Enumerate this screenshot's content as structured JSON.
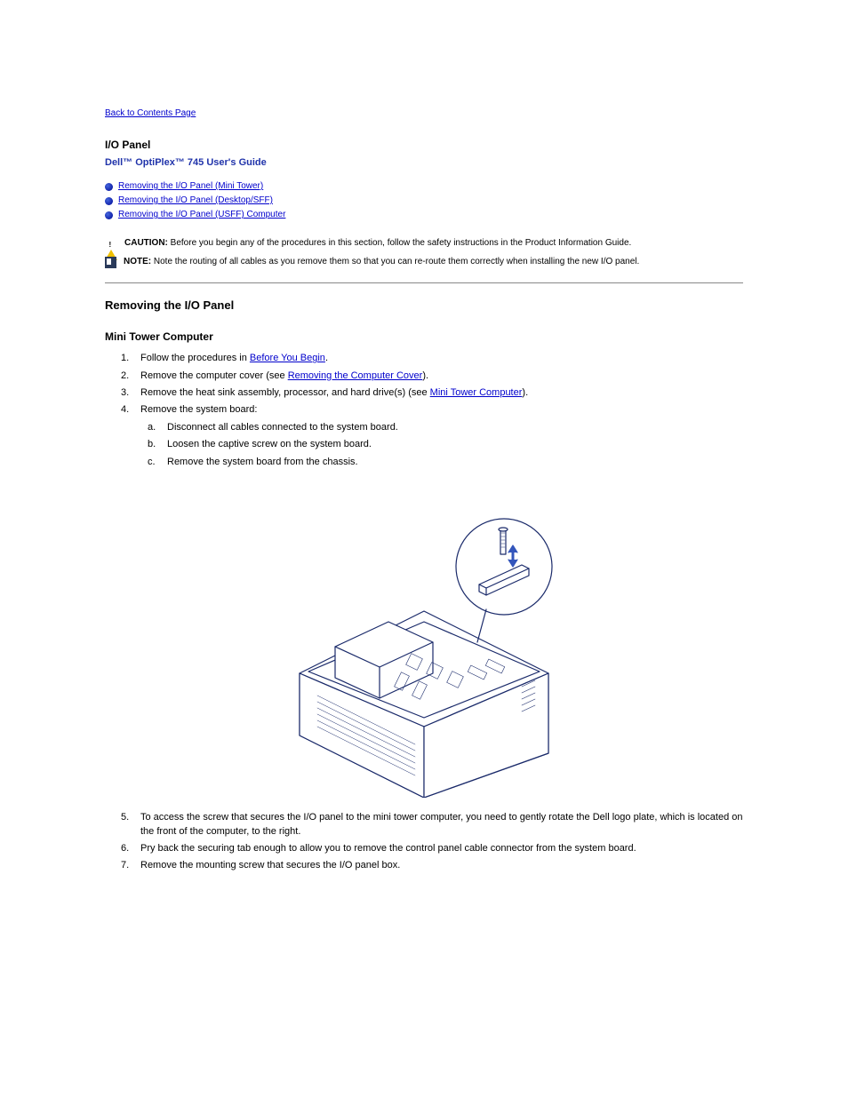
{
  "back_link": "Back to Contents Page",
  "title": "I/O Panel",
  "subtitle": "Dell™ OptiPlex™ 745 User's Guide",
  "toc": [
    {
      "label": "Removing the I/O Panel (Mini Tower)"
    },
    {
      "label": "Removing the I/O Panel (Desktop/SFF)"
    },
    {
      "label": "Removing the I/O Panel (USFF) Computer"
    }
  ],
  "caution": {
    "prefix": "CAUTION:",
    "text": "Before you begin any of the procedures in this section, follow the safety instructions in the Product Information Guide."
  },
  "note": {
    "prefix": "NOTE:",
    "text": "Note the routing of all cables as you remove them so that you can re-route them correctly when installing the new I/O panel."
  },
  "section": {
    "heading": "Removing the I/O Panel",
    "subheading": "Mini Tower Computer",
    "steps": [
      {
        "num": "1.",
        "parts": [
          "Follow the procedures in ",
          "Before You Begin",
          "."
        ]
      },
      {
        "num": "2.",
        "parts": [
          "Remove the computer cover (see ",
          "Removing the Computer Cover",
          ")."
        ]
      },
      {
        "num": "3.",
        "parts": [
          "Remove the heat sink assembly, processor, and hard drive(s) (see ",
          "Mini Tower Computer",
          ")."
        ]
      },
      {
        "num": "4.",
        "parts": [
          "Remove the system board:"
        ]
      }
    ],
    "substeps": [
      {
        "letter": "a.",
        "text": "Disconnect all cables connected to the system board."
      },
      {
        "letter": "b.",
        "text": "Loosen the captive screw on the system board."
      },
      {
        "letter": "c.",
        "text": "Remove the system board from the chassis."
      }
    ]
  },
  "continuation": {
    "step5": {
      "num": "5.",
      "text": "To access the screw that secures the I/O panel to the mini tower computer, you need to gently rotate the Dell logo plate, which is located on the front of the computer, to the right."
    },
    "step6": {
      "num": "6.",
      "text": "Pry back the securing tab enough to allow you to remove the control panel cable connector from the system board."
    },
    "step7": {
      "num": "7.",
      "text": "Remove the mounting screw that secures the I/O panel box."
    }
  }
}
